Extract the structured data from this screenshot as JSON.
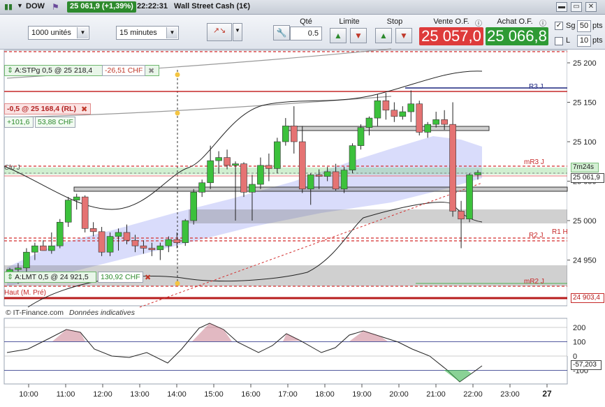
{
  "titlebar": {
    "symbol": "DOW",
    "price_change": "25 061,9 (+1,39%)",
    "time": "22:22:31",
    "name": "Wall Street Cash (1€)"
  },
  "toolbar": {
    "units": "1000 unités",
    "timeframe": "15 minutes",
    "qty_label": "Qté",
    "qty_value": "0.5",
    "limit_label": "Limite",
    "stop_label": "Stop",
    "sell_label": "Vente O.F.",
    "sell_price": "25 057,0",
    "buy_label": "Achat O.F.",
    "buy_price": "25 066,8",
    "sg_label": "Sg",
    "sg_pts": "50",
    "l_label": "L",
    "l_pts": "10",
    "pts_label": "pts"
  },
  "orders": {
    "stop_tag": "A:STPg  0,5 @ 25 218,4",
    "stop_pnl": "-26,51 CHF",
    "position_tag": "-0,5 @ 25 168,4 (RL)",
    "position_pts": "+101,6",
    "position_pnl": "53,88 CHF",
    "limit_tag": "A:LMT  0,5 @ 24 921,5",
    "limit_pnl": "130,92 CHF"
  },
  "levels": {
    "r3": "R3 J",
    "mr3": "mR3 J",
    "r2": "R2 J",
    "r1": "R1 H",
    "mr2": "mR2 J",
    "clo": "Clo J",
    "haut": "Haut (M. Pré)",
    "countdown": "7m24s",
    "current": "25 061,9",
    "haut_value": "24 903,4"
  },
  "footer": {
    "source": "© IT-Finance.com",
    "note": "Données indicatives"
  },
  "oscillator": {
    "current": "-57,203"
  },
  "colors": {
    "bull": "#3cc13c",
    "bear": "#e57373",
    "sell": "#de3b3b",
    "buy": "#2f9a35"
  },
  "chart_data": {
    "type": "candlestick",
    "y_ticks": [
      25200,
      25150,
      25100,
      25050,
      25000,
      24950
    ],
    "x_ticks": [
      "10:00",
      "11:00",
      "12:00",
      "13:00",
      "14:00",
      "15:00",
      "16:00",
      "17:00",
      "18:00",
      "19:00",
      "20:00",
      "21:00",
      "22:00",
      "23:00",
      "27"
    ],
    "ylim": [
      24880,
      25220
    ],
    "candles": [
      {
        "o": 24935,
        "h": 24940,
        "l": 24925,
        "c": 24938
      },
      {
        "o": 24938,
        "h": 24946,
        "l": 24920,
        "c": 24940
      },
      {
        "o": 24940,
        "h": 24965,
        "l": 24932,
        "c": 24960
      },
      {
        "o": 24960,
        "h": 24972,
        "l": 24950,
        "c": 24968
      },
      {
        "o": 24968,
        "h": 24975,
        "l": 24962,
        "c": 24962
      },
      {
        "o": 24962,
        "h": 24985,
        "l": 24958,
        "c": 24968
      },
      {
        "o": 24968,
        "h": 25002,
        "l": 24965,
        "c": 24998
      },
      {
        "o": 24998,
        "h": 25030,
        "l": 24992,
        "c": 25026
      },
      {
        "o": 25026,
        "h": 25034,
        "l": 25014,
        "c": 25030
      },
      {
        "o": 25030,
        "h": 25032,
        "l": 24985,
        "c": 24990
      },
      {
        "o": 24990,
        "h": 24998,
        "l": 24980,
        "c": 24986
      },
      {
        "o": 24986,
        "h": 24992,
        "l": 24955,
        "c": 24960
      },
      {
        "o": 24960,
        "h": 24985,
        "l": 24955,
        "c": 24980
      },
      {
        "o": 24980,
        "h": 24990,
        "l": 24962,
        "c": 24985
      },
      {
        "o": 24985,
        "h": 24995,
        "l": 24970,
        "c": 24975
      },
      {
        "o": 24975,
        "h": 24982,
        "l": 24960,
        "c": 24968
      },
      {
        "o": 24968,
        "h": 24975,
        "l": 24958,
        "c": 24965
      },
      {
        "o": 24965,
        "h": 24972,
        "l": 24955,
        "c": 24963
      },
      {
        "o": 24963,
        "h": 24972,
        "l": 24950,
        "c": 24968
      },
      {
        "o": 24968,
        "h": 24980,
        "l": 24960,
        "c": 24976
      },
      {
        "o": 24976,
        "h": 24985,
        "l": 24965,
        "c": 24972
      },
      {
        "o": 24972,
        "h": 25002,
        "l": 24968,
        "c": 25000
      },
      {
        "o": 25000,
        "h": 25040,
        "l": 24995,
        "c": 25036
      },
      {
        "o": 25036,
        "h": 25052,
        "l": 25030,
        "c": 25048
      },
      {
        "o": 25048,
        "h": 25095,
        "l": 25040,
        "c": 25076
      },
      {
        "o": 25076,
        "h": 25088,
        "l": 25060,
        "c": 25080
      },
      {
        "o": 25080,
        "h": 25090,
        "l": 25065,
        "c": 25070
      },
      {
        "o": 25070,
        "h": 25075,
        "l": 25000,
        "c": 25072
      },
      {
        "o": 25072,
        "h": 25074,
        "l": 25030,
        "c": 25036
      },
      {
        "o": 25036,
        "h": 25058,
        "l": 25000,
        "c": 25046
      },
      {
        "o": 25046,
        "h": 25080,
        "l": 25040,
        "c": 25070
      },
      {
        "o": 25070,
        "h": 25085,
        "l": 25050,
        "c": 25066
      },
      {
        "o": 25066,
        "h": 25105,
        "l": 25060,
        "c": 25100
      },
      {
        "o": 25100,
        "h": 25130,
        "l": 25095,
        "c": 25120
      },
      {
        "o": 25120,
        "h": 25145,
        "l": 25085,
        "c": 25100
      },
      {
        "o": 25100,
        "h": 25120,
        "l": 25035,
        "c": 25040
      },
      {
        "o": 25040,
        "h": 25060,
        "l": 25020,
        "c": 25058
      },
      {
        "o": 25058,
        "h": 25065,
        "l": 25040,
        "c": 25056
      },
      {
        "o": 25056,
        "h": 25068,
        "l": 25050,
        "c": 25062
      },
      {
        "o": 25062,
        "h": 25072,
        "l": 25038,
        "c": 25040
      },
      {
        "o": 25040,
        "h": 25068,
        "l": 25035,
        "c": 25064
      },
      {
        "o": 25064,
        "h": 25098,
        "l": 25060,
        "c": 25095
      },
      {
        "o": 25095,
        "h": 25122,
        "l": 25090,
        "c": 25118
      },
      {
        "o": 25118,
        "h": 25132,
        "l": 25108,
        "c": 25130
      },
      {
        "o": 25130,
        "h": 25160,
        "l": 25120,
        "c": 25152
      },
      {
        "o": 25152,
        "h": 25162,
        "l": 25128,
        "c": 25140
      },
      {
        "o": 25140,
        "h": 25150,
        "l": 25125,
        "c": 25132
      },
      {
        "o": 25132,
        "h": 25145,
        "l": 25128,
        "c": 25138
      },
      {
        "o": 25138,
        "h": 25165,
        "l": 25125,
        "c": 25148
      },
      {
        "o": 25148,
        "h": 25152,
        "l": 25108,
        "c": 25112
      },
      {
        "o": 25112,
        "h": 25125,
        "l": 25105,
        "c": 25122
      },
      {
        "o": 25122,
        "h": 25138,
        "l": 25118,
        "c": 25128
      },
      {
        "o": 25128,
        "h": 25140,
        "l": 25115,
        "c": 25122
      },
      {
        "o": 25122,
        "h": 25150,
        "l": 25005,
        "c": 25012
      },
      {
        "o": 25012,
        "h": 25025,
        "l": 24965,
        "c": 25002
      },
      {
        "o": 25002,
        "h": 25060,
        "l": 24998,
        "c": 25058
      },
      {
        "o": 25058,
        "h": 25064,
        "l": 25052,
        "c": 25061
      }
    ]
  }
}
